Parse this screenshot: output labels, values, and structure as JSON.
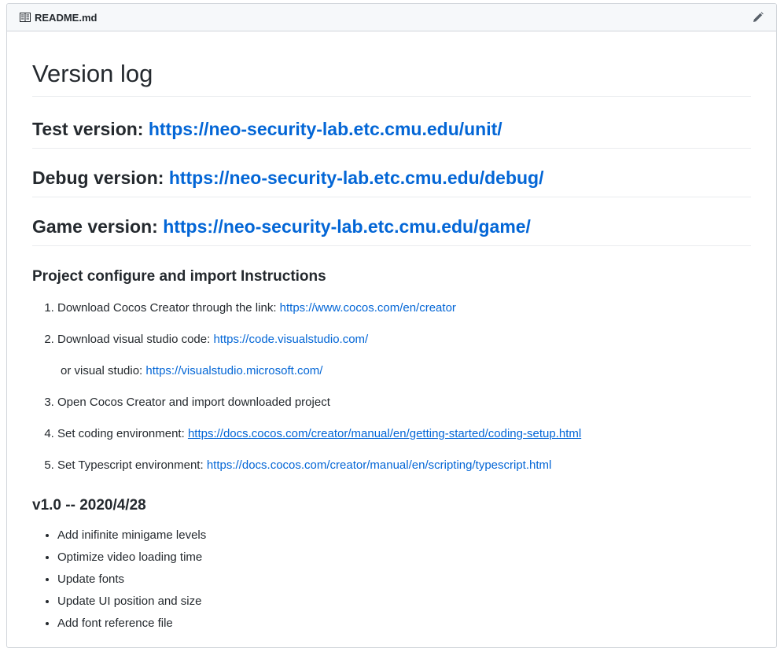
{
  "file_header": {
    "icon": "book-icon",
    "filename": "README.md",
    "edit_icon": "pencil-icon"
  },
  "readme": {
    "title": "Version log",
    "versions": [
      {
        "label": "Test version:",
        "url": "https://neo-security-lab.etc.cmu.edu/unit/"
      },
      {
        "label": "Debug version:",
        "url": "https://neo-security-lab.etc.cmu.edu/debug/"
      },
      {
        "label": "Game version:",
        "url": "https://neo-security-lab.etc.cmu.edu/game/"
      }
    ],
    "instructions": {
      "heading": "Project configure and import Instructions",
      "steps": [
        {
          "text": "Download Cocos Creator through the link: ",
          "link": "https://www.cocos.com/en/creator"
        },
        {
          "text": "Download visual studio code: ",
          "link": "https://code.visualstudio.com/",
          "sub_text": "or visual studio: ",
          "sub_link": "https://visualstudio.microsoft.com/"
        },
        {
          "text": "Open Cocos Creator and import downloaded project"
        },
        {
          "text": "Set coding environment: ",
          "link": "https://docs.cocos.com/creator/manual/en/getting-started/coding-setup.html"
        },
        {
          "text": "Set Typescript environment: ",
          "link": "https://docs.cocos.com/creator/manual/en/scripting/typescript.html"
        }
      ]
    },
    "release": {
      "heading": "v1.0 -- 2020/4/28",
      "changes": [
        "Add inifinite minigame levels",
        "Optimize video loading time",
        "Update fonts",
        "Update UI position and size",
        "Add font reference file"
      ]
    }
  },
  "colors": {
    "link": "#0366d6",
    "text": "#24292e",
    "header_bg": "#f6f8fa",
    "border": "#d1d5da"
  }
}
